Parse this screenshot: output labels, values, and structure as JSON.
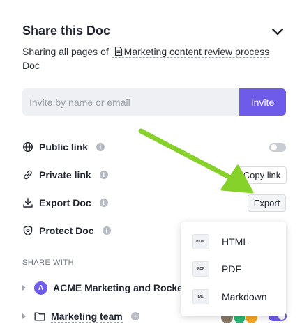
{
  "panel": {
    "title": "Share this Doc",
    "sharing_prefix": "Sharing all pages of",
    "doc_name": "Marketing content review process",
    "doc_suffix": "Doc"
  },
  "invite": {
    "placeholder": "Invite by name or email",
    "button_label": "Invite"
  },
  "options": {
    "public_link": {
      "label": "Public link",
      "enabled": false
    },
    "private_link": {
      "label": "Private link",
      "action": "Copy link"
    },
    "export_doc": {
      "label": "Export Doc",
      "action": "Export"
    },
    "protect_doc": {
      "label": "Protect Doc"
    }
  },
  "share_with": {
    "heading": "SHARE WITH",
    "entries": [
      {
        "avatar": "A",
        "name": "ACME Marketing and Rocke"
      },
      {
        "name": "Marketing team",
        "enabled": true
      }
    ]
  },
  "export_menu": {
    "items": [
      {
        "icon_text": "HTML",
        "label": "HTML"
      },
      {
        "icon_text": "PDF",
        "label": "PDF"
      },
      {
        "icon_text": "M↓",
        "label": "Markdown"
      }
    ]
  },
  "colors": {
    "accent": "#6e5bea",
    "arrow": "#86d12a",
    "face_colors": [
      "#8a7a68",
      "#2bb673",
      "#f5a623"
    ]
  }
}
